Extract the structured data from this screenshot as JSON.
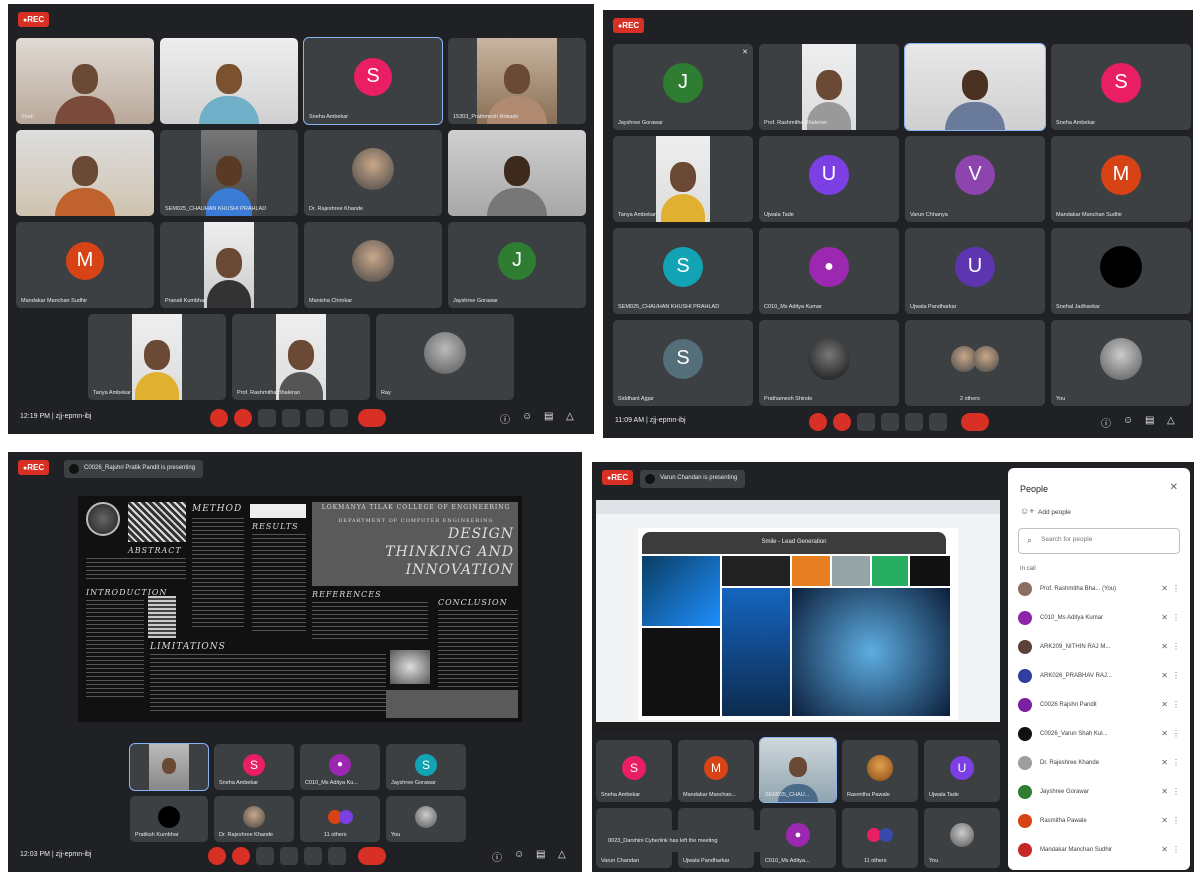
{
  "q1": {
    "rec": "REC",
    "time": "12:19 PM | zjj-epmn-ibj",
    "tiles": [
      {
        "name": "Shah"
      },
      {
        "name": ""
      },
      {
        "name": "Sneha Ambekar",
        "letter": "S"
      },
      {
        "name": "15303_Prathmesh Rokade"
      },
      {
        "name": ""
      },
      {
        "name": "SEM025_CHAUHAN KHUSHI PRAHLAD"
      },
      {
        "name": "Dr. Rajeshree Khande"
      },
      {
        "name": ""
      },
      {
        "name": "Mandakar Manchan Sudhir",
        "letter": "M"
      },
      {
        "name": "Pranali Kumbhar"
      },
      {
        "name": "Manisha Chirokar"
      },
      {
        "name": "Jayshree Gorawar",
        "letter": "J"
      },
      {
        "name": "Tanya Ambekar"
      },
      {
        "name": "Prof. Rashmitha Bhalerao"
      },
      {
        "name": "Ray"
      }
    ]
  },
  "q2": {
    "rec": "REC",
    "time": "11:09 AM | zjj-epmn-ibj",
    "tiles": [
      {
        "name": "Jayshree Gorawar",
        "letter": "J"
      },
      {
        "name": "Prof. Rashmitha Bhalerao"
      },
      {
        "name": ""
      },
      {
        "name": "Sneha Ambekar",
        "letter": "S"
      },
      {
        "name": "Tanya Ambekar"
      },
      {
        "name": "Ujwala Tade",
        "letter": "U"
      },
      {
        "name": "Varun Chhanya",
        "letter": "V"
      },
      {
        "name": "Mandakar Manchan Sudhir",
        "letter": "M"
      },
      {
        "name": "SEM025_CHAUHAN KHUSHI PRAHLAD",
        "letter": "S"
      },
      {
        "name": "C010_Ms Aditya Kumar"
      },
      {
        "name": "Ujwala Pandharkar",
        "letter": "U"
      },
      {
        "name": "Snehal Jadhavkar"
      },
      {
        "name": "Siddhant Ajgar",
        "letter": "S"
      },
      {
        "name": "Prathamesh Shinde"
      },
      {
        "name": "2 others"
      },
      {
        "name": "You"
      }
    ]
  },
  "q3": {
    "rec": "REC",
    "presenter": "C0026_Rajshri Pratik Pandit is presenting",
    "poster": {
      "college": "LOKMANYA TILAK COLLEGE OF ENGINEERING",
      "dept": "DEPARTMENT OF COMPUTER ENGINEERING",
      "title1": "DESIGN",
      "title2": "THINKING AND",
      "title3": "INNOVATION",
      "method": "METHOD",
      "abstract": "ABSTRACT",
      "results": "RESULTS",
      "introduction": "INTRODUCTION",
      "limitations": "LIMITATIONS",
      "references": "REFERENCES",
      "conclusion": "CONCLUSION"
    },
    "time": "12:03 PM | zjj-epmn-ibj",
    "tiles": [
      {
        "name": ""
      },
      {
        "name": "Sneha Ambekar",
        "letter": "S"
      },
      {
        "name": "C010_Ms Aditya Ku..."
      },
      {
        "name": "Jayshree Gorawar",
        "letter": "S"
      },
      {
        "name": "Pratiksh Kumbhar"
      },
      {
        "name": "Dr. Rajeshree Khande"
      },
      {
        "name": "11 others"
      },
      {
        "name": "You"
      }
    ]
  },
  "q4": {
    "rec": "REC",
    "presenter": "Varun Chandan is presenting",
    "slide_title": "Smile - Lead Generation",
    "notice": "0023_Darshini Cyberlink has left the meeting",
    "tiles": [
      {
        "name": "Sneha Ambekar",
        "letter": "S"
      },
      {
        "name": "Mandakar Manchan...",
        "letter": "M"
      },
      {
        "name": "SEM025_CHAU..."
      },
      {
        "name": "Rasmitha Pawale"
      },
      {
        "name": "Ujwala Tade",
        "letter": "U"
      },
      {
        "name": "Varun Chandan"
      },
      {
        "name": "Ujwala Pandharkar"
      },
      {
        "name": "C010_Ms Aditya..."
      },
      {
        "name": "11 others"
      },
      {
        "name": "You"
      }
    ],
    "people_panel": {
      "title": "People",
      "add_people": "Add people",
      "search_placeholder": "Search for people",
      "section": "In call",
      "people": [
        {
          "name": "Prof. Rashmitha Bha... (You)",
          "color": "#8d6e63"
        },
        {
          "name": "C010_Ms Aditya Kumar",
          "color": "#8e24aa"
        },
        {
          "name": "ARK209_NITHIN RAJ M...",
          "color": "#5d4037"
        },
        {
          "name": "ARK026_PRABHAV RAJ...",
          "color": "#303f9f"
        },
        {
          "name": "C0026 Rajshri Pandit",
          "color": "#7b1fa2"
        },
        {
          "name": "C0026_Varun Shah Kul...",
          "color": "#111111"
        },
        {
          "name": "Dr. Rajeshree Khande",
          "color": "#9e9e9e"
        },
        {
          "name": "Jayshree Gorawar",
          "color": "#2e7d32"
        },
        {
          "name": "Rasmitha Pawale",
          "color": "#d84315"
        },
        {
          "name": "Mandakar Manchan Sudhir",
          "color": "#c62828"
        }
      ]
    }
  }
}
